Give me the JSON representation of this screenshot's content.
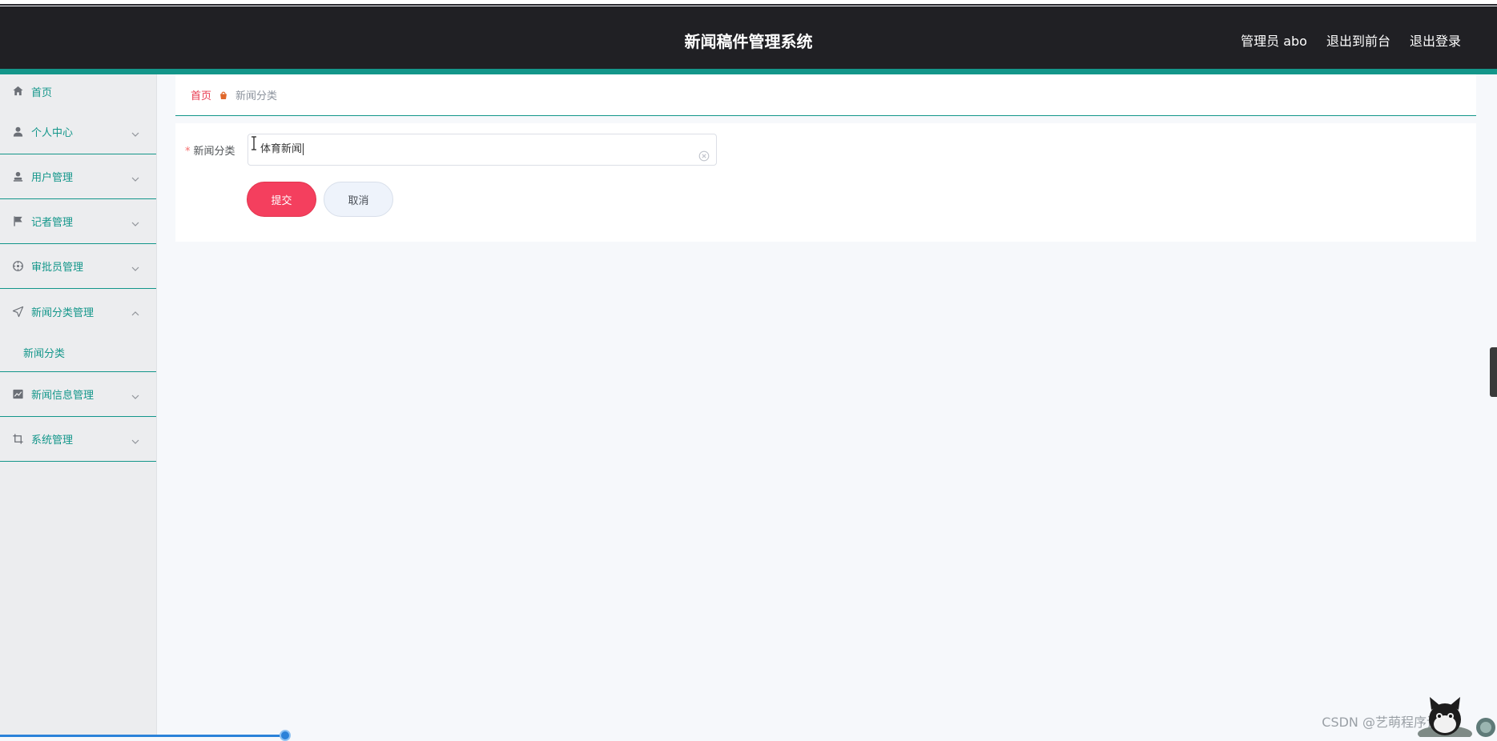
{
  "header": {
    "title": "新闻稿件管理系统",
    "user_label": "管理员 abo",
    "to_front_label": "退出到前台",
    "logout_label": "退出登录"
  },
  "sidebar": {
    "items": [
      {
        "label": "首页",
        "icon": "home-icon"
      },
      {
        "label": "个人中心",
        "icon": "user-icon"
      },
      {
        "label": "用户管理",
        "icon": "user-stamp-icon"
      },
      {
        "label": "记者管理",
        "icon": "flag-icon"
      },
      {
        "label": "审批员管理",
        "icon": "compass-icon"
      },
      {
        "label": "新闻分类管理",
        "icon": "location-arrow-icon"
      },
      {
        "label": "新闻信息管理",
        "icon": "trend-chart-icon"
      },
      {
        "label": "系统管理",
        "icon": "crop-icon"
      }
    ],
    "submenu": {
      "label": "新闻分类"
    }
  },
  "breadcrumb": {
    "home": "首页",
    "current": "新闻分类"
  },
  "form": {
    "field_label": "新闻分类",
    "required_mark": "*",
    "field_value": "体育新闻",
    "submit_label": "提交",
    "cancel_label": "取消"
  },
  "watermark": "CSDN @艺萌程序设计",
  "colors": {
    "header_bg": "#202024",
    "accent": "#13968a",
    "submit": "#f43f5e"
  }
}
